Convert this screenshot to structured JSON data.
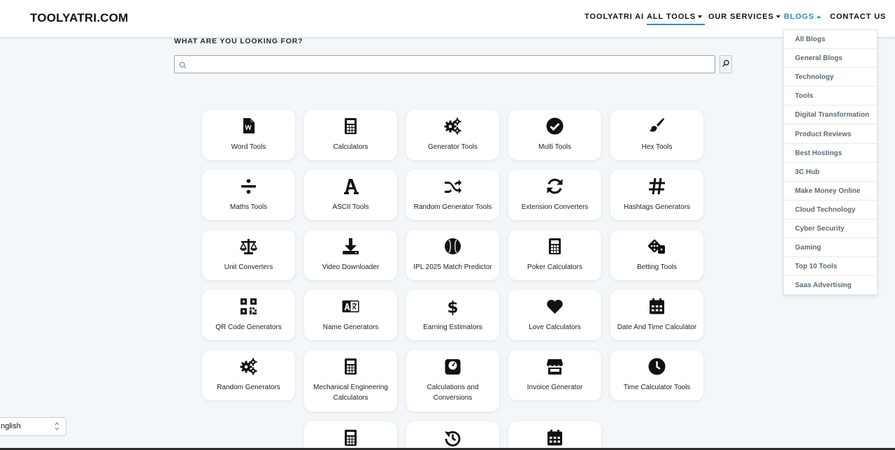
{
  "header": {
    "brand": "TOOLYATRI.COM",
    "nav": {
      "ai": "TOOLYATRI AI",
      "all_tools": "ALL TOOLS",
      "services": "OUR SERVICES",
      "blogs": "BLOGS",
      "contact": "CONTACT US"
    },
    "accent_color": "#2a8fbd"
  },
  "search": {
    "label": "WHAT ARE YOU LOOKING FOR?",
    "value": "",
    "placeholder": ""
  },
  "tools": [
    {
      "label": "Word Tools",
      "icon": "word-file-icon"
    },
    {
      "label": "Calculators",
      "icon": "calculator-icon"
    },
    {
      "label": "Generator Tools",
      "icon": "gears-icon"
    },
    {
      "label": "Multi Tools",
      "icon": "check-circle-icon"
    },
    {
      "label": "Hex Tools",
      "icon": "paint-brush-icon"
    },
    {
      "label": "Maths Tools",
      "icon": "divide-icon"
    },
    {
      "label": "ASCII Tools",
      "icon": "font-a-icon"
    },
    {
      "label": "Random Generator Tools",
      "icon": "shuffle-icon"
    },
    {
      "label": "Extension Converters",
      "icon": "sync-icon"
    },
    {
      "label": "Hashtags Generators",
      "icon": "hashtag-icon"
    },
    {
      "label": "Unit Converters",
      "icon": "balance-scale-icon"
    },
    {
      "label": "Video Downloader",
      "icon": "download-icon"
    },
    {
      "label": "IPL 2025 Match Predictor",
      "icon": "cricket-ball-icon"
    },
    {
      "label": "Poker Calculators",
      "icon": "calculator-icon"
    },
    {
      "label": "Betting Tools",
      "icon": "dice-icon"
    },
    {
      "label": "QR Code Generators",
      "icon": "qrcode-icon"
    },
    {
      "label": "Name Generators",
      "icon": "language-icon"
    },
    {
      "label": "Earning Estimators",
      "icon": "dollar-icon"
    },
    {
      "label": "Love Calculators",
      "icon": "heart-icon"
    },
    {
      "label": "Date And Time Calculator",
      "icon": "calendar-icon"
    },
    {
      "label": "Random Generators",
      "icon": "gears-icon"
    },
    {
      "label": "Mechanical Engineering Calculators",
      "icon": "calculator-icon"
    },
    {
      "label": "Calculations and Conversions",
      "icon": "weight-scale-icon"
    },
    {
      "label": "Invoice Generator",
      "icon": "store-icon"
    },
    {
      "label": "Time Calculator Tools",
      "icon": "clock-icon"
    },
    {
      "label": "",
      "icon": "calculator-icon"
    },
    {
      "label": "",
      "icon": "history-icon"
    },
    {
      "label": "",
      "icon": "calendar-icon"
    }
  ],
  "blogs_menu": [
    "All Blogs",
    "General Blogs",
    "Technology",
    "Tools",
    "Digital Transformation",
    "Product Reviews",
    "Best Hostings",
    "3C Hub",
    "Make Money Online",
    "Cloud Technology",
    "Cyber Security",
    "Gaming",
    "Top 10 Tools",
    "Saas Advertising"
  ],
  "language": {
    "selected": "nglish"
  }
}
